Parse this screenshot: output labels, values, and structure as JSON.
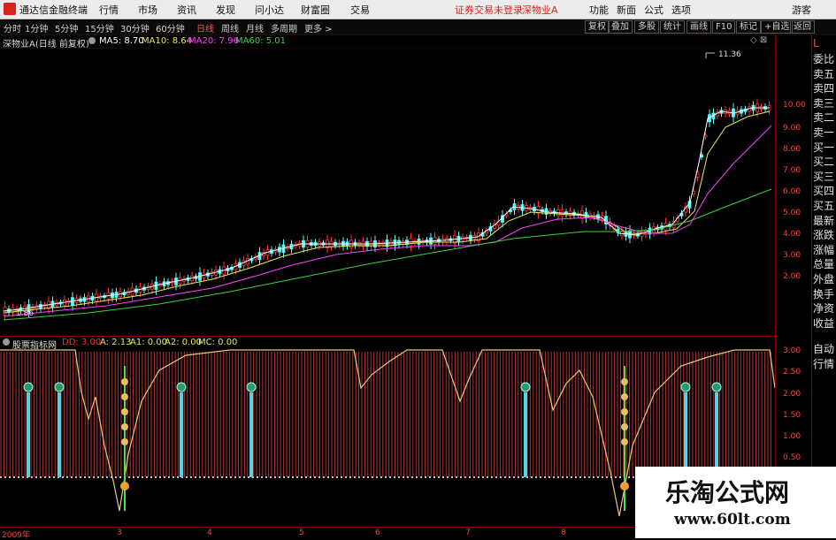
{
  "titlebar": {
    "app": "通达信金融终端",
    "menus": [
      "行情",
      "市场",
      "资讯",
      "发现",
      "问小达",
      "财富圈",
      "交易"
    ],
    "notice": "证券交易未登录",
    "stock": "深物业A",
    "right": [
      "功能",
      "新面",
      "公式",
      "选项"
    ],
    "guest": "游客"
  },
  "toolbar": {
    "periods": [
      "分时",
      "1分钟",
      "5分钟",
      "15分钟",
      "30分钟",
      "60分钟",
      "日线",
      "周线",
      "月线",
      "多周期",
      "更多 >"
    ],
    "active": "日线",
    "buttons": [
      "复权",
      "叠加",
      "多股",
      "统计",
      "画线",
      "F10",
      "标记",
      "+自选",
      "返回"
    ]
  },
  "info": {
    "stock": "深物业A(日线 前复权)",
    "ma5": "MA5: 8.70",
    "ma10": "MA10: 8.64",
    "ma20": "MA20: 7.96",
    "ma60": "MA60: 5.01",
    "peak": "11.36",
    "low": "1.86"
  },
  "indicator": {
    "name": "股票指标网",
    "dd": "DD: 3.00",
    "a": "A: 2.13",
    "a1": "A1: 0.00",
    "a2": "A2: 0.00",
    "mc": "MC: 0.00"
  },
  "yaxis_main": [
    "10.00",
    "9.00",
    "8.00",
    "7.00",
    "6.00",
    "5.00",
    "4.00",
    "3.00",
    "2.00"
  ],
  "yaxis_ind": [
    "3.00",
    "2.50",
    "2.00",
    "1.50",
    "1.00",
    "0.50"
  ],
  "dates": [
    "2009年",
    "3",
    "4",
    "5",
    "6",
    "7",
    "8"
  ],
  "sidebar": {
    "top": "L",
    "labels": [
      "委比",
      "卖五",
      "卖四",
      "卖三",
      "卖二",
      "卖一",
      "买一",
      "买二",
      "买三",
      "买四",
      "买五",
      "最新",
      "涨跌",
      "涨幅",
      "总量",
      "外盘",
      "换手",
      "净资",
      "收益"
    ],
    "bottom": [
      "自动",
      "行情"
    ]
  },
  "watermark": {
    "title": "乐淘公式网",
    "url": "www.60lt.com"
  },
  "colors": {
    "up": "#ff3030",
    "down": "#54fcfc",
    "ma5": "#ffffff",
    "ma10": "#e8e85a",
    "ma20": "#ff40ff",
    "ma60": "#3ecf3e",
    "axis": "#800000"
  },
  "chart_data": {
    "type": "line",
    "title": "深物业A(日线 前复权)",
    "ylim": [
      1.5,
      11.5
    ],
    "series": [
      {
        "name": "MA60",
        "points": [
          [
            0,
            1.86
          ],
          [
            0.1,
            2.05
          ],
          [
            0.2,
            2.25
          ],
          [
            0.3,
            2.55
          ],
          [
            0.4,
            2.85
          ],
          [
            0.5,
            3.2
          ],
          [
            0.6,
            3.45
          ],
          [
            0.7,
            3.6
          ],
          [
            0.8,
            3.8
          ],
          [
            0.9,
            4.4
          ],
          [
            1.0,
            5.01
          ]
        ]
      }
    ]
  }
}
